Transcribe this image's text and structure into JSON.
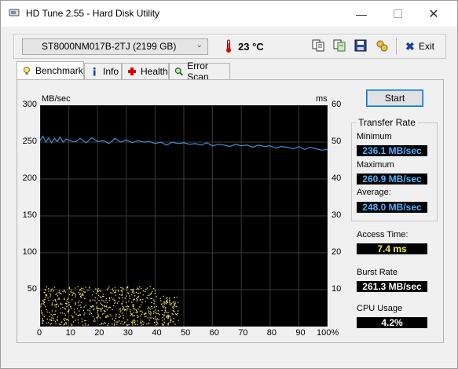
{
  "window": {
    "title": "HD Tune 2.55 - Hard Disk Utility"
  },
  "toolbar": {
    "drive": "ST8000NM017B-2TJ (2199 GB)",
    "temperature": "23 °C",
    "exit_label": "Exit"
  },
  "tabs": [
    {
      "label": "Benchmark",
      "active": true
    },
    {
      "label": "Info"
    },
    {
      "label": "Health"
    },
    {
      "label": "Error Scan"
    }
  ],
  "start_label": "Start",
  "transfer": {
    "group_title": "Transfer Rate",
    "minimum_label": "Minimum",
    "minimum": "236.1 MB/sec",
    "maximum_label": "Maximum",
    "maximum": "260.9 MB/sec",
    "average_label": "Average:",
    "average": "248.0 MB/sec"
  },
  "access": {
    "label": "Access Time:",
    "value": "7.4 ms"
  },
  "burst": {
    "label": "Burst Rate",
    "value": "261.3 MB/sec"
  },
  "cpu": {
    "label": "CPU Usage",
    "value": "4.2%"
  },
  "colors": {
    "transfer_line": "#3f8fd8",
    "access_dots": "#e8e06a",
    "value_blue": "#4fb3ff",
    "value_yellow": "#f5f04a"
  },
  "chart_data": {
    "type": "line",
    "left_unit": "MB/sec",
    "right_unit": "ms",
    "left_ticks": [
      "300",
      "250",
      "200",
      "150",
      "100",
      "50"
    ],
    "right_ticks": [
      "60",
      "50",
      "40",
      "30",
      "20",
      "10"
    ],
    "x_ticks": [
      "0",
      "10",
      "20",
      "30",
      "40",
      "50",
      "60",
      "70",
      "80",
      "90",
      "100%"
    ],
    "xlim": [
      0,
      100
    ],
    "ylim_left": [
      0,
      300
    ],
    "ylim_right": [
      0,
      60
    ],
    "grid": true,
    "series": [
      {
        "x": [
          0,
          1,
          2,
          3,
          4,
          5,
          6,
          7,
          8,
          9,
          10,
          12,
          14,
          16,
          18,
          20,
          22,
          24,
          26,
          28,
          30,
          32,
          34,
          36,
          38,
          40,
          42,
          44,
          46,
          48,
          50,
          52,
          54,
          56,
          58,
          60,
          62,
          64,
          66,
          68,
          70,
          72,
          74,
          76,
          78,
          80,
          82,
          84,
          86,
          88,
          90,
          92,
          94,
          96,
          98,
          100
        ],
        "y": [
          252,
          258,
          250,
          256,
          249,
          255,
          251,
          257,
          250,
          254,
          253,
          250,
          255,
          249,
          256,
          251,
          252,
          248,
          255,
          250,
          253,
          249,
          252,
          250,
          251,
          248,
          250,
          246,
          250,
          248,
          249,
          247,
          248,
          246,
          249,
          245,
          247,
          246,
          244,
          247,
          245,
          246,
          243,
          246,
          244,
          245,
          242,
          244,
          243,
          241,
          244,
          240,
          243,
          241,
          239,
          240
        ]
      }
    ],
    "access_time_ms_range": [
      0,
      11
    ],
    "access_time_x_range": [
      0,
      48
    ]
  }
}
